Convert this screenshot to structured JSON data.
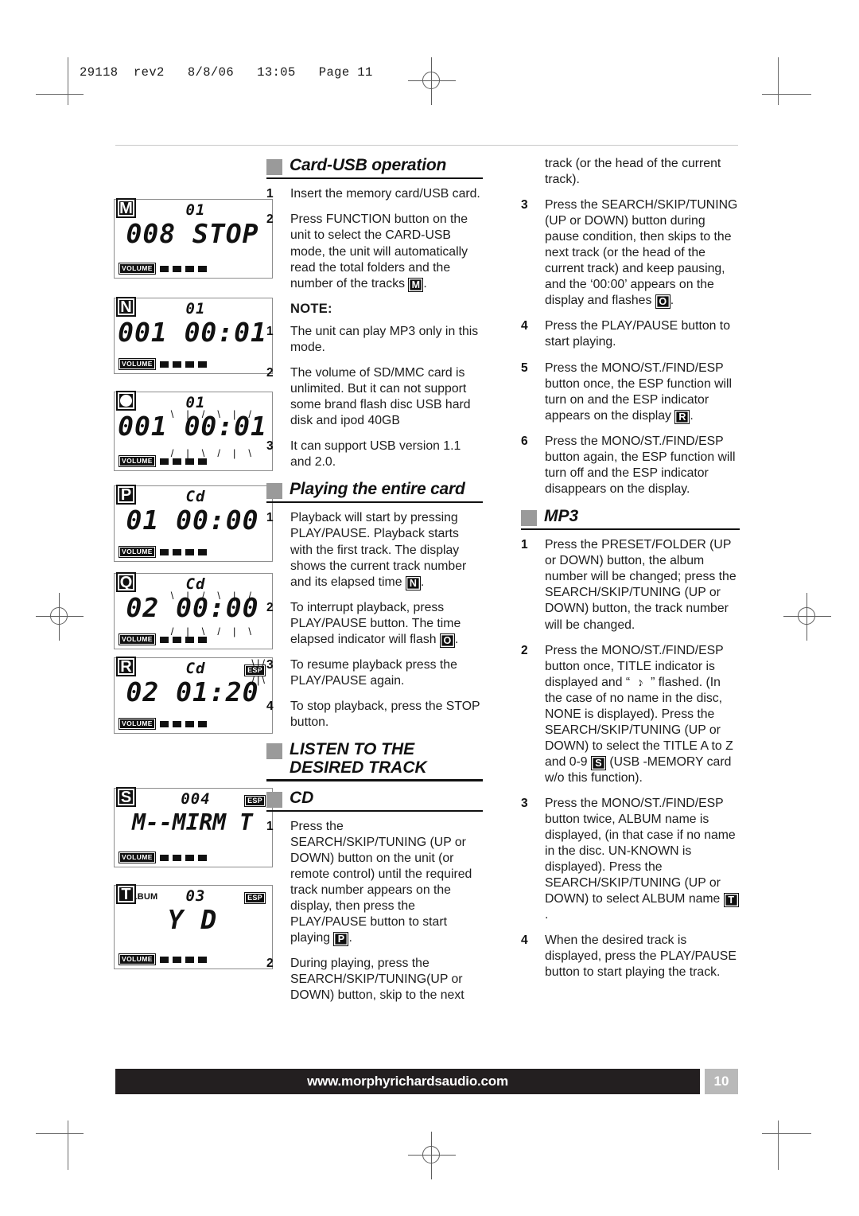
{
  "page": {
    "slug": "29118  rev2   8/8/06   13:05   Page 11",
    "footer_url": "www.morphyrichardsaudio.com",
    "footer_page_number": "10"
  },
  "displays": [
    {
      "marker": "M",
      "marker_style": "letter",
      "top_value": "01",
      "main_value": "008 STOP",
      "volume_label": "VOLUME",
      "volume_bars": 4,
      "esp": false,
      "flashing": false
    },
    {
      "marker": "N",
      "marker_style": "letter",
      "top_value": "01",
      "main_value": "001 00:01",
      "volume_label": "VOLUME",
      "volume_bars": 4,
      "esp": false,
      "flashing": false
    },
    {
      "marker": "O",
      "marker_style": "circle",
      "top_value": "01",
      "main_value": "001 00:01",
      "volume_label": "VOLUME",
      "volume_bars": 4,
      "esp": false,
      "flashing": true
    },
    {
      "marker": "P",
      "marker_style": "letter",
      "top_value": "Cd",
      "main_value": "01 00:00",
      "volume_label": "VOLUME",
      "volume_bars": 4,
      "esp": false,
      "flashing": false
    },
    {
      "marker": "Q",
      "marker_style": "letter",
      "top_value": "Cd",
      "main_value": "02 00:00",
      "volume_label": "VOLUME",
      "volume_bars": 4,
      "esp": false,
      "flashing": true
    },
    {
      "marker": "R",
      "marker_style": "letter",
      "top_value": "Cd",
      "main_value": "02 01:20",
      "volume_label": "VOLUME",
      "volume_bars": 4,
      "esp": true,
      "esp_label": "ESP",
      "esp_flashing": true,
      "flashing": false
    },
    {
      "marker": "S",
      "marker_style": "letter",
      "top_value": "004",
      "main_value": "M--MIRM T",
      "volume_label": "VOLUME",
      "volume_bars": 4,
      "esp": true,
      "esp_label": "ESP",
      "esp_flashing": false,
      "note_icon": true,
      "flashing": false
    },
    {
      "marker": "T",
      "marker_style": "letter",
      "album_tag": "ALBUM",
      "top_value": "03",
      "main_value": "Y D",
      "volume_label": "VOLUME",
      "volume_bars": 4,
      "esp": true,
      "esp_label": "ESP",
      "esp_flashing": false,
      "flashing": false
    }
  ],
  "middle_column": {
    "sections": [
      {
        "title": "Card-USB operation",
        "style": "italic",
        "steps": [
          {
            "num": "1",
            "text": "Insert the memory card/USB card."
          },
          {
            "num": "2",
            "text": "Press FUNCTION button on the unit to select the CARD-USB mode, the unit will automatically read the total folders and the number of the tracks ",
            "marker": "M",
            "text_after": "."
          }
        ]
      },
      {
        "note_title": "NOTE:",
        "steps": [
          {
            "num": "1",
            "text": "The unit can play MP3 only in this mode."
          },
          {
            "num": "2",
            "text": "The volume of SD/MMC card is unlimited. But it can not support some brand flash disc USB hard disk and ipod 40GB"
          },
          {
            "num": "3",
            "text": "It can support USB version 1.1 and 2.0."
          }
        ]
      },
      {
        "title": "Playing the entire card",
        "style": "italic",
        "steps": [
          {
            "num": "1",
            "text": "Playback will start by pressing PLAY/PAUSE. Playback starts with the first track. The display shows the current track number and its elapsed time ",
            "marker": "N",
            "text_after": "."
          },
          {
            "num": "2",
            "text": "To interrupt playback, press PLAY/PAUSE button. The time elapsed indicator will flash ",
            "marker": "O",
            "text_after": "."
          },
          {
            "num": "3",
            "text": "To resume playback press the PLAY/PAUSE again."
          },
          {
            "num": "4",
            "text": "To stop playback, press the STOP button."
          }
        ]
      },
      {
        "title": "LISTEN TO THE DESIRED TRACK",
        "style": "caps",
        "steps": []
      },
      {
        "title": "CD",
        "style": "caps",
        "steps": [
          {
            "num": "1",
            "text": "Press the SEARCH/SKIP/TUNING (UP or DOWN) button on the unit  (or remote control) until the required track number appears on the display, then press the PLAY/PAUSE button to start playing ",
            "marker": "P",
            "text_after": "."
          },
          {
            "num": "2",
            "text": "During playing, press the SEARCH/SKIP/TUNING(UP or DOWN) button, skip to the next"
          }
        ]
      }
    ]
  },
  "right_column": {
    "continuation_text": "track (or the head of the current track).",
    "sections": [
      {
        "steps": [
          {
            "num": "3",
            "text": "Press the SEARCH/SKIP/TUNING (UP or DOWN) button during pause condition, then skips to the next track (or the head of the current track) and keep pausing, and the ‘00:00’ appears on the display and flashes ",
            "marker": "O",
            "text_after": "."
          },
          {
            "num": "4",
            "text": "Press the PLAY/PAUSE button to start playing."
          },
          {
            "num": "5",
            "text": "Press the MONO/ST./FIND/ESP button once, the ESP function will turn on and the ESP indicator appears on the display ",
            "marker": "R",
            "text_after": "."
          },
          {
            "num": "6",
            "text": "Press the MONO/ST./FIND/ESP button again, the ESP function will turn off and the ESP indicator disappears on the display."
          }
        ]
      },
      {
        "title": "MP3",
        "style": "caps",
        "steps": [
          {
            "num": "1",
            "text": "Press the PRESET/FOLDER (UP or DOWN) button, the album number will be changed; press the SEARCH/SKIP/TUNING (UP or DOWN) button, the track number will be changed."
          },
          {
            "num": "2",
            "text_pre": "Press the MONO/ST./FIND/ESP button once, TITLE indicator is displayed and “",
            "note_glyph": "♪",
            "text_mid": "” flashed. (In the case of no name in the disc, NONE is displayed). Press the SEARCH/SKIP/TUNING (UP or DOWN) to select the TITLE A to Z and 0-9 ",
            "marker": "S",
            "text_after": " (USB -MEMORY card w/o this function)."
          },
          {
            "num": "3",
            "text": "Press the MONO/ST./FIND/ESP button twice, ALBUM name is displayed, (in that case if no name in the disc. UN-KNOWN is displayed). Press the SEARCH/SKIP/TUNING (UP or DOWN) to select ALBUM name ",
            "marker": "T",
            "text_after": "."
          },
          {
            "num": "4",
            "text": "When the desired track is displayed, press the PLAY/PAUSE button to start playing the track."
          }
        ]
      }
    ]
  }
}
